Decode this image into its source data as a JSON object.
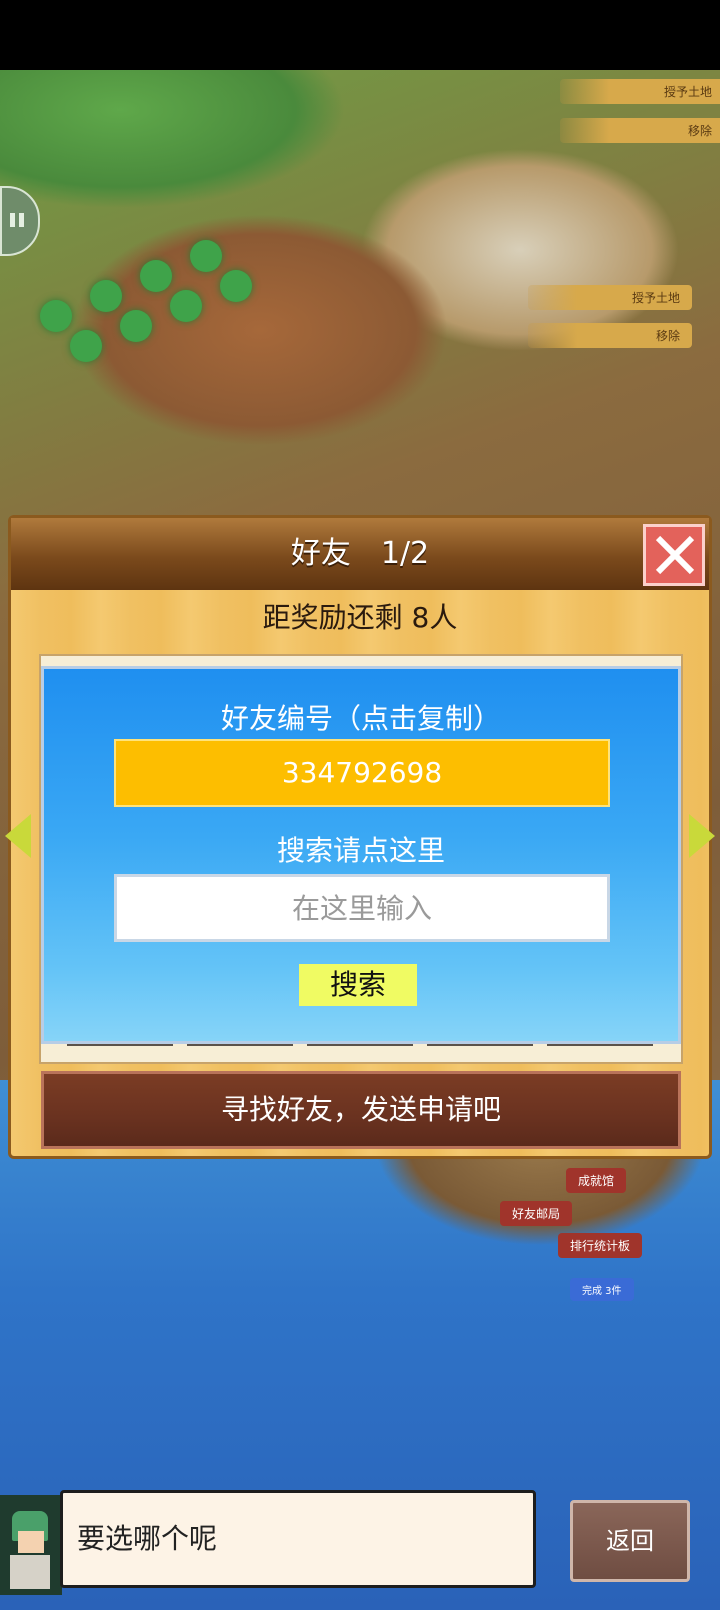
{
  "map_labels": {
    "grant_land": "授予土地",
    "remove": "移除",
    "achievement_hall": "成就馆",
    "friend_post_office": "好友邮局",
    "ranking_board": "排行统计板",
    "complete_badge": "完成 3件"
  },
  "dialog": {
    "title": "好友　1/2",
    "reward_text": "距奖励还剩 8人",
    "friend_id_label": "好友编号（点击复制）",
    "friend_id": "334792698",
    "search_label": "搜索请点这里",
    "search_placeholder": "在这里输入",
    "search_button": "搜索",
    "find_friends_button": "寻找好友，发送申请吧"
  },
  "bottom": {
    "speech_text": "要选哪个呢",
    "back_button": "返回"
  },
  "colors": {
    "id_box": "#fdbe00",
    "panel_blue": "#3aa8f4",
    "close_red": "#e3625b"
  }
}
